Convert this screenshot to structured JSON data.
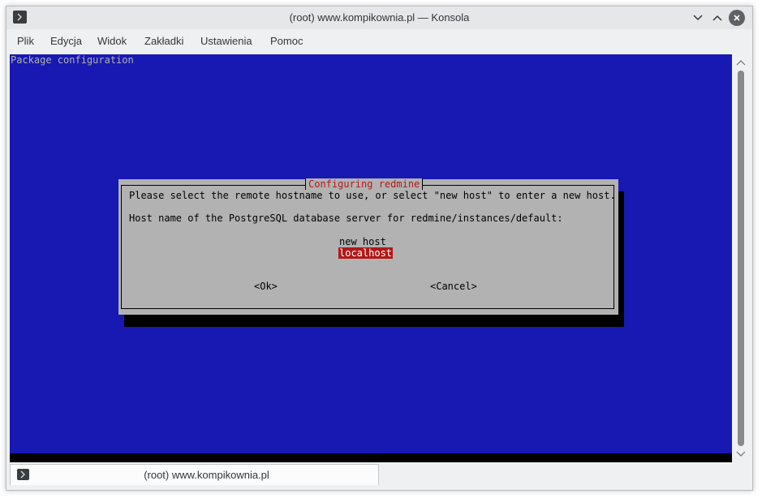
{
  "window": {
    "title": "(root) www.kompikownia.pl — Konsola"
  },
  "menu": {
    "items": [
      "Plik",
      "Edycja",
      "Widok",
      "Zakładki",
      "Ustawienia",
      "Pomoc"
    ]
  },
  "terminal": {
    "header": "Package configuration",
    "dialog": {
      "title": "Configuring redmine",
      "prompt_line1": "Please select the remote hostname to use, or select \"new host\" to enter a new host.",
      "prompt_line2": "Host name of the PostgreSQL database server for redmine/instances/default:",
      "options": [
        "new host",
        "localhost"
      ],
      "selected_option": "localhost",
      "ok_label": "<Ok>",
      "cancel_label": "<Cancel>"
    }
  },
  "tabs": [
    {
      "label": "(root) www.kompikownia.pl"
    }
  ],
  "colors": {
    "terminal_bg": "#1818b2",
    "dialog_bg": "#b2b2b2",
    "accent_red": "#b21818"
  }
}
